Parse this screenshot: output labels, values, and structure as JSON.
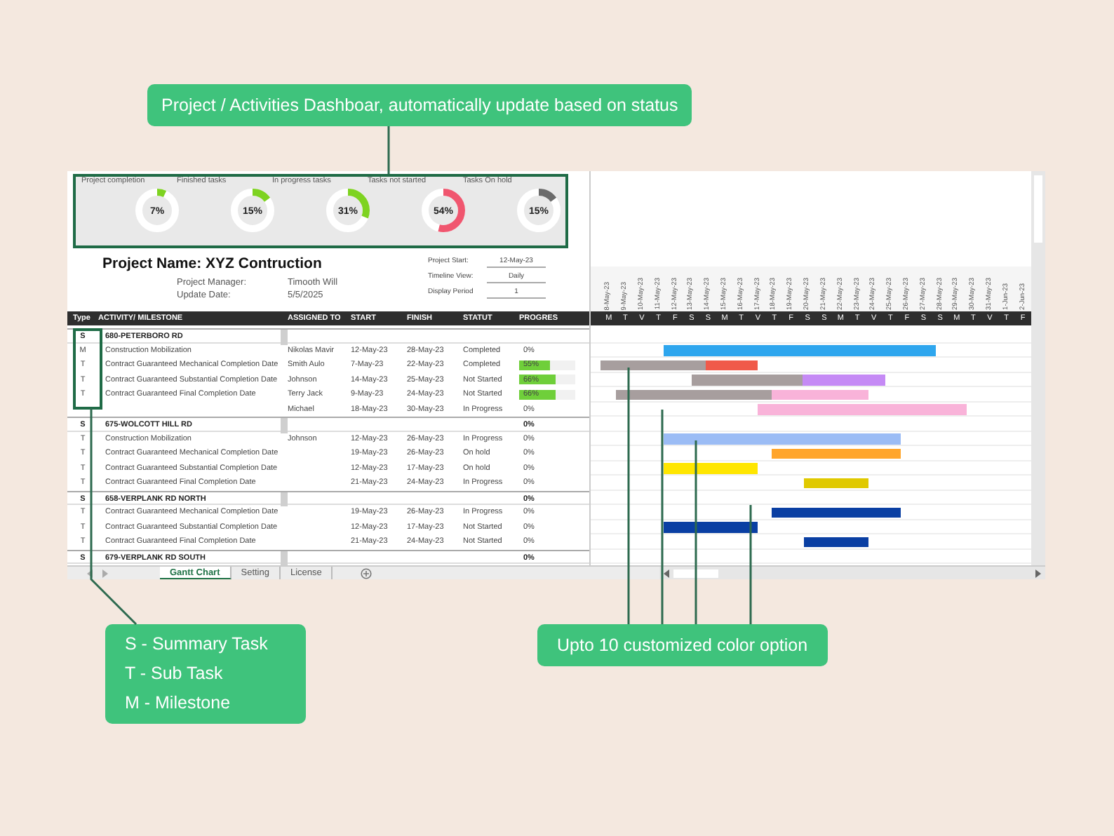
{
  "dashboard_callout": {
    "text": "Project / Activities Dashboar, automatically update based on status"
  },
  "dashboard": {
    "metrics": [
      {
        "label": "Project completion",
        "value": "7%",
        "level": 0.07,
        "color": "#7ed321"
      },
      {
        "label": "Finished tasks",
        "value": "15%",
        "level": 0.15,
        "color": "#7ed321"
      },
      {
        "label": "In progress tasks",
        "value": "31%",
        "level": 0.31,
        "color": "#7ed321"
      },
      {
        "label": "Tasks not started",
        "value": "54%",
        "level": 0.54,
        "color": "#f0566f"
      },
      {
        "label": "Tasks On hold",
        "value": "15%",
        "level": 0.15,
        "color": "#6b6b6b"
      }
    ]
  },
  "project": {
    "title": "Project Name: XYZ Contruction",
    "fields": [
      {
        "label": "Project Manager:",
        "value": "Timooth Will"
      },
      {
        "label": "Update Date:",
        "value": "5/5/2025"
      }
    ],
    "settings": [
      {
        "label": "Project Start:",
        "value": "12-May-23"
      },
      {
        "label": "Timeline View:",
        "value": "Daily"
      },
      {
        "label": "Display Period",
        "value": "1"
      }
    ]
  },
  "table": {
    "columns": [
      "Type",
      "ACTIVITY/ MILESTONE",
      "ASSIGNED TO",
      "START",
      "FINISH",
      "STATUT",
      "PROGRES"
    ],
    "rows": [
      {
        "kind": "summary",
        "type": "S",
        "activity": "680-PETERBORO RD"
      },
      {
        "kind": "task",
        "type": "M",
        "activity": "Construction Mobilization",
        "assigned": "Nikolas Mavir",
        "start": "12-May-23",
        "finish": "28-May-23",
        "status": "Completed",
        "progress": "0%"
      },
      {
        "kind": "task",
        "type": "T",
        "activity": "Contract Guaranteed Mechanical Completion Date",
        "assigned": "Smith Aulo",
        "start": "7-May-23",
        "finish": "22-May-23",
        "status": "Completed",
        "progress": "55%",
        "level": 0.55
      },
      {
        "kind": "task",
        "type": "T",
        "activity": "Contract Guaranteed Substantial Completion Date",
        "assigned": "Johnson",
        "start": "14-May-23",
        "finish": "25-May-23",
        "status": "Not Started",
        "progress": "66%",
        "level": 0.66
      },
      {
        "kind": "task",
        "type": "T",
        "activity": "Contract Guaranteed Final Completion Date",
        "assigned": "Terry Jack",
        "start": "9-May-23",
        "finish": "24-May-23",
        "status": "Not Started",
        "progress": "66%",
        "level": 0.66
      },
      {
        "kind": "task",
        "assigned": "Michael",
        "start": "18-May-23",
        "finish": "30-May-23",
        "status": "In Progress",
        "progress": "0%"
      },
      {
        "kind": "summary",
        "type": "S",
        "activity": "675-WOLCOTT HILL RD",
        "progress": "0%"
      },
      {
        "kind": "task",
        "type": "T",
        "activity": "Construction Mobilization",
        "assigned": "Johnson",
        "start": "12-May-23",
        "finish": "26-May-23",
        "status": "In Progress",
        "progress": "0%"
      },
      {
        "kind": "task",
        "type": "T",
        "activity": "Contract Guaranteed Mechanical Completion Date",
        "start": "19-May-23",
        "finish": "26-May-23",
        "status": "On hold",
        "progress": "0%"
      },
      {
        "kind": "task",
        "type": "T",
        "activity": "Contract Guaranteed Substantial Completion Date",
        "start": "12-May-23",
        "finish": "17-May-23",
        "status": "On hold",
        "progress": "0%"
      },
      {
        "kind": "task",
        "type": "T",
        "activity": "Contract Guaranteed Final Completion Date",
        "start": "21-May-23",
        "finish": "24-May-23",
        "status": "In Progress",
        "progress": "0%"
      },
      {
        "kind": "summary",
        "type": "S",
        "activity": "658-VERPLANK RD NORTH",
        "progress": "0%"
      },
      {
        "kind": "task",
        "type": "T",
        "activity": "Contract Guaranteed Mechanical Completion Date",
        "start": "19-May-23",
        "finish": "26-May-23",
        "status": "In Progress",
        "progress": "0%"
      },
      {
        "kind": "task",
        "type": "T",
        "activity": "Contract Guaranteed Substantial Completion Date",
        "start": "12-May-23",
        "finish": "17-May-23",
        "status": "Not Started",
        "progress": "0%"
      },
      {
        "kind": "task",
        "type": "T",
        "activity": "Contract Guaranteed Final Completion Date",
        "start": "21-May-23",
        "finish": "24-May-23",
        "status": "Not Started",
        "progress": "0%"
      },
      {
        "kind": "summary",
        "type": "S",
        "activity": "679-VERPLANK RD SOUTH",
        "progress": "0%"
      }
    ]
  },
  "gantt": {
    "dates": [
      "8-May-23",
      "9-May-23",
      "10-May-23",
      "11-May-23",
      "12-May-23",
      "13-May-23",
      "14-May-23",
      "15-May-23",
      "16-May-23",
      "17-May-23",
      "18-May-23",
      "19-May-23",
      "20-May-23",
      "21-May-23",
      "22-May-23",
      "23-May-23",
      "24-May-23",
      "25-May-23",
      "26-May-23",
      "27-May-23",
      "28-May-23",
      "29-May-23",
      "30-May-23",
      "31-May-23",
      "1-Jun-23",
      "2-Jun-23"
    ],
    "weekdays": [
      "M",
      "T",
      "V",
      "T",
      "F",
      "S",
      "S",
      "M",
      "T",
      "V",
      "T",
      "F",
      "S",
      "S",
      "M",
      "T",
      "V",
      "T",
      "F",
      "S",
      "S",
      "M",
      "T",
      "V",
      "T",
      "F"
    ]
  },
  "sheet_tabs": [
    {
      "label": "Gantt Chart",
      "selected": true
    },
    {
      "label": "Setting",
      "selected": false
    },
    {
      "label": "License",
      "selected": false
    }
  ],
  "legend_callout": {
    "lines": [
      "S - Summary Task",
      "T - Sub Task",
      "M - Milestone"
    ]
  },
  "color_callout": {
    "text": "Upto 10 customized color option"
  }
}
